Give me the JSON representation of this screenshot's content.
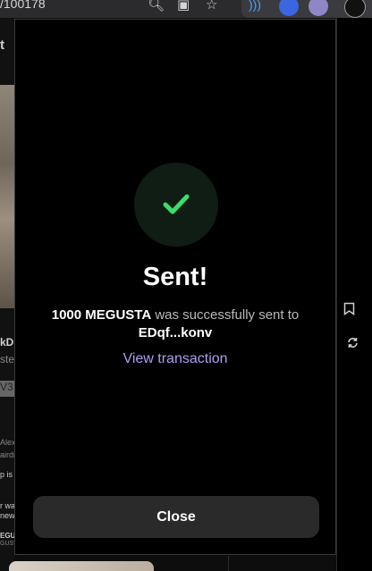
{
  "browser": {
    "url_fragment": "/100178"
  },
  "background": {
    "left_texts": [
      "t",
      "kD",
      "ste",
      "V3",
      "Alex",
      "airdr",
      "p is",
      "r wa",
      "new",
      "EGUS",
      "GUSTA"
    ]
  },
  "modal": {
    "title": "Sent!",
    "amount": "1000 MEGUSTA",
    "middle_text": "was successfully sent to",
    "recipient": "EDqf...konv",
    "view_transaction_label": "View transaction",
    "close_label": "Close"
  },
  "colors": {
    "accent": "#ab9ff2",
    "success": "#3ddc6e",
    "success_bg": "#0f1d14",
    "button_bg": "#2a2a2a"
  },
  "icons": [
    "zoom-icon",
    "cast-icon",
    "star-icon",
    "extension-icons",
    "checkmark-icon",
    "bookmark-icon",
    "repost-icon"
  ]
}
